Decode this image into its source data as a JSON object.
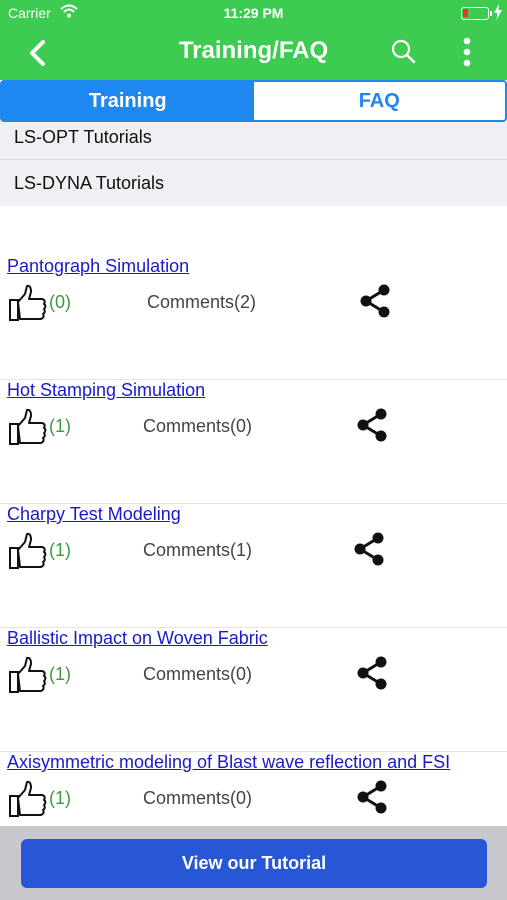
{
  "status_bar": {
    "carrier": "Carrier",
    "time": "11:29 PM"
  },
  "header": {
    "title": "Training/FAQ"
  },
  "tabs": [
    {
      "label": "Training",
      "active": true
    },
    {
      "label": "FAQ",
      "active": false
    }
  ],
  "categories": [
    "LS-OPT Tutorials",
    "LS-DYNA Tutorials"
  ],
  "items": [
    {
      "title": "Pantograph Simulation",
      "likes": "(0)",
      "comments": "Comments(2)"
    },
    {
      "title": "Hot Stamping Simulation",
      "likes": "(1)",
      "comments": "Comments(0)"
    },
    {
      "title": "Charpy Test Modeling",
      "likes": "(1)",
      "comments": "Comments(1)"
    },
    {
      "title": "Ballistic Impact on Woven Fabric",
      "likes": "(1)",
      "comments": "Comments(0)"
    },
    {
      "title": "Axisymmetric modeling of Blast wave reflection and FSI",
      "likes": "(1)",
      "comments": "Comments(0)"
    }
  ],
  "bottom_button": {
    "label": "View our Tutorial"
  },
  "colors": {
    "header_green": "#3dcb52",
    "tab_blue": "#1e87f0",
    "link_blue": "#1a1acc",
    "like_green": "#3e9a3e",
    "button_blue": "#2757d6"
  },
  "icons": [
    "back-chevron-icon",
    "search-icon",
    "more-vertical-icon",
    "thumbs-up-icon",
    "share-icon",
    "wifi-icon",
    "battery-icon"
  ]
}
